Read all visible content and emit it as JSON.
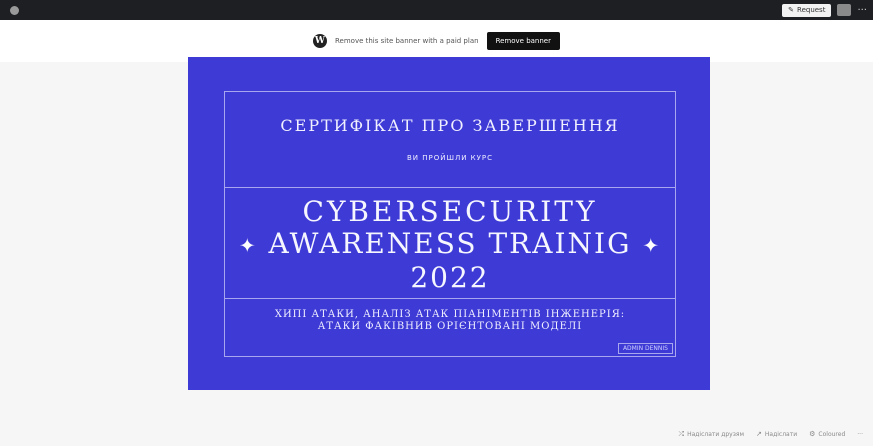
{
  "admin_bar": {
    "site_label": "",
    "site_name": "",
    "request_label": "Request",
    "more_label": "···"
  },
  "banner": {
    "logo_glyph": "W",
    "text": "Remove this site banner with a paid plan",
    "button_label": "Remove banner"
  },
  "certificate": {
    "title": "СЕРТИФІКАТ ПРО ЗАВЕРШЕННЯ",
    "subtitle": "ВИ ПРОЙШЛИ КУРС",
    "course_line1": "CYBERSECURITY",
    "course_line2": "AWARENESS TRAINIG",
    "course_line3": "2022",
    "sparkle": "✦",
    "description_line1": "ХИПІ АТАКИ, АНАЛІЗ АТАК ПІАНІМЕНТІВ ІНЖЕНЕРІЯ:",
    "description_line2": "АТАКИ ФАКІВНИВ ОРІЄНТОВАНІ МОДЕЛІ",
    "signature": "ADMIN DENNIS"
  },
  "bottom_toolbar": {
    "item1": "Надіслати друзям",
    "item2": "Надіслати",
    "item3": "Coloured",
    "item4": "···"
  }
}
